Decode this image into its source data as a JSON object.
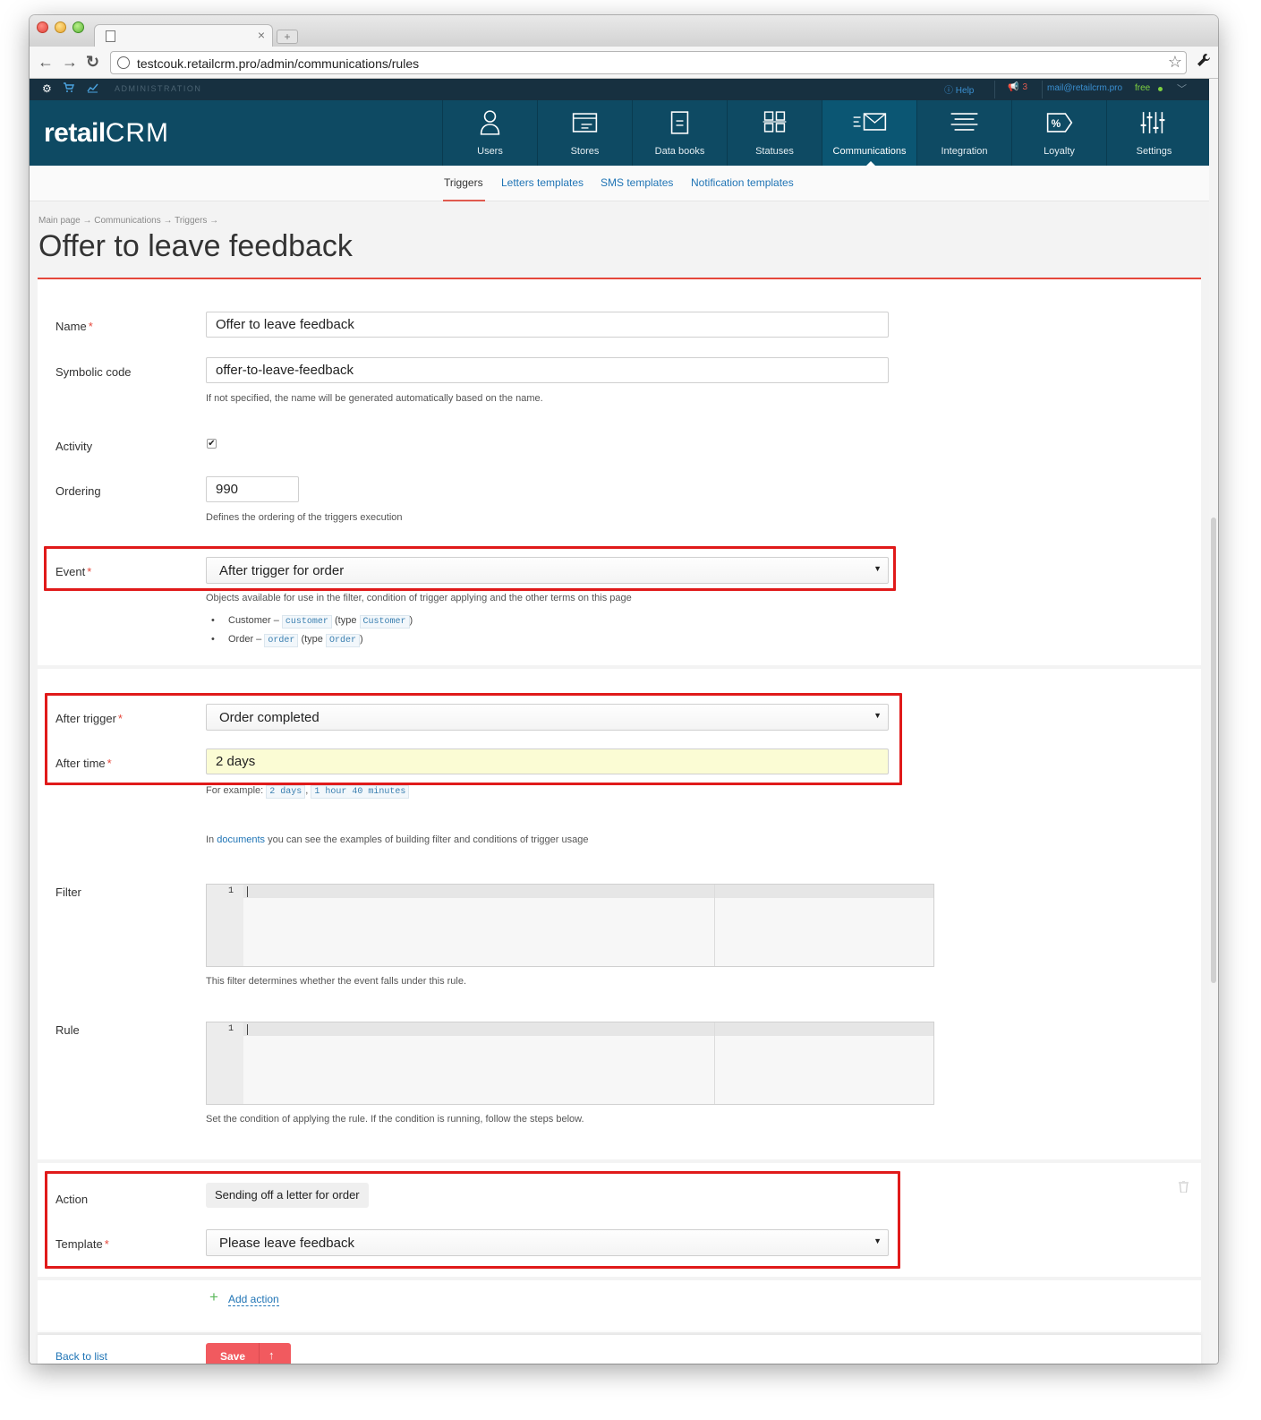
{
  "browser": {
    "url": "testcouk.retailcrm.pro/admin/communications/rules",
    "tab_title": "",
    "tab_close": "×",
    "new_tab": "+"
  },
  "adminbar": {
    "section": "ADMINISTRATION",
    "help": "Help",
    "notifications_count": "3",
    "email": "mail@retailcrm.pro",
    "plan": "free"
  },
  "header": {
    "logo_text": "retail",
    "logo_crm": "CRM",
    "nav": [
      {
        "label": "Users",
        "icon": "user-icon"
      },
      {
        "label": "Stores",
        "icon": "store-icon"
      },
      {
        "label": "Data books",
        "icon": "book-icon"
      },
      {
        "label": "Statuses",
        "icon": "grid-icon"
      },
      {
        "label": "Communications",
        "icon": "envelope-icon",
        "active": true
      },
      {
        "label": "Integration",
        "icon": "lines-icon"
      },
      {
        "label": "Loyalty",
        "icon": "percent-tag-icon"
      },
      {
        "label": "Settings",
        "icon": "sliders-icon"
      }
    ]
  },
  "subnav": {
    "tabs": [
      "Triggers",
      "Letters templates",
      "SMS templates",
      "Notification templates"
    ]
  },
  "page": {
    "breadcrumb": "Main page → Communications → Triggers →",
    "title": "Offer to leave feedback"
  },
  "form": {
    "name_label": "Name",
    "name_value": "Offer to leave feedback",
    "code_label": "Symbolic code",
    "code_value": "offer-to-leave-feedback",
    "code_hint": "If not specified, the name will be generated automatically based on the name.",
    "activity_label": "Activity",
    "activity_checked": "✔",
    "ordering_label": "Ordering",
    "ordering_value": "990",
    "ordering_hint": "Defines the ordering of the triggers execution",
    "event_label": "Event",
    "event_value": "After trigger for order",
    "event_hint": "Objects available for use in the filter, condition of trigger applying and the other terms on this page",
    "objects": [
      {
        "name": "Customer –",
        "var": "customer",
        "type_prefix": "(type",
        "type": "Customer",
        "close": ")"
      },
      {
        "name": "Order –",
        "var": "order",
        "type_prefix": "(type",
        "type": "Order",
        "close": ")"
      }
    ],
    "after_trigger_label": "After trigger",
    "after_trigger_value": "Order completed",
    "after_time_label": "After time",
    "after_time_value": "2 days",
    "example_prefix": "For example:",
    "example_1": "2 days",
    "example_sep": ",",
    "example_2": "1 hour 40 minutes",
    "docs_prefix": "In",
    "docs_link": "documents",
    "docs_suffix": "you can see the examples of building filter and conditions of trigger usage",
    "filter_label": "Filter",
    "filter_line": "1",
    "filter_hint": "This filter determines whether the event falls under this rule.",
    "rule_label": "Rule",
    "rule_line": "1",
    "rule_hint": "Set the condition of applying the rule. If the condition is running, follow the steps below.",
    "action_label": "Action",
    "action_value": "Sending off a letter for order",
    "template_label": "Template",
    "template_value": "Please leave feedback",
    "add_action": "Add action",
    "required_mark": "*",
    "select_arrow": "▼"
  },
  "footer": {
    "back": "Back to list",
    "save": "Save"
  },
  "colors": {
    "header_bg": "#0e4a63",
    "adminbar_bg": "#173040",
    "accent_red": "#e5473b",
    "link": "#1f74b5",
    "save_button": "#f15a5f",
    "highlight_box": "#e01a1a"
  }
}
